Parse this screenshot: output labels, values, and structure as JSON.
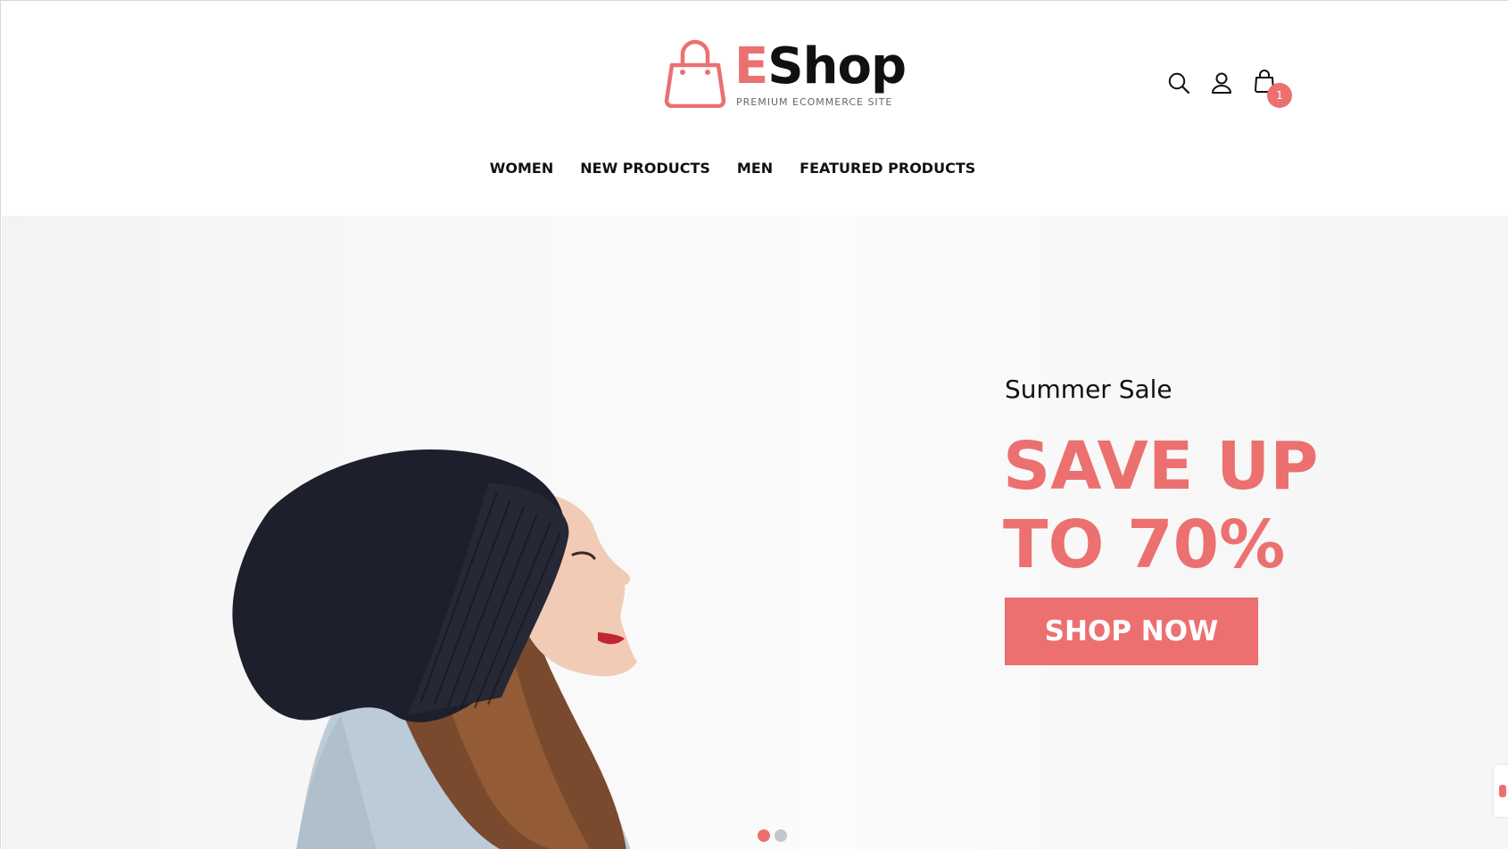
{
  "brand": {
    "logo_initial": "E",
    "logo_rest": "Shop",
    "tagline": "PREMIUM ECOMMERCE SITE",
    "accent_color": "#ec7070"
  },
  "header_icons": {
    "search": "search-icon",
    "account": "user-icon",
    "cart": "shopping-bag-icon",
    "cart_count": "1"
  },
  "nav": {
    "items": [
      {
        "label": "WOMEN"
      },
      {
        "label": "NEW PRODUCTS"
      },
      {
        "label": "MEN"
      },
      {
        "label": "FEATURED PRODUCTS"
      }
    ]
  },
  "hero": {
    "kicker": "Summer Sale",
    "headline_line1": "SAVE UP",
    "headline_line2": "TO 70%",
    "cta_label": "SHOP NOW",
    "slide_count": 2,
    "active_slide": 1
  }
}
